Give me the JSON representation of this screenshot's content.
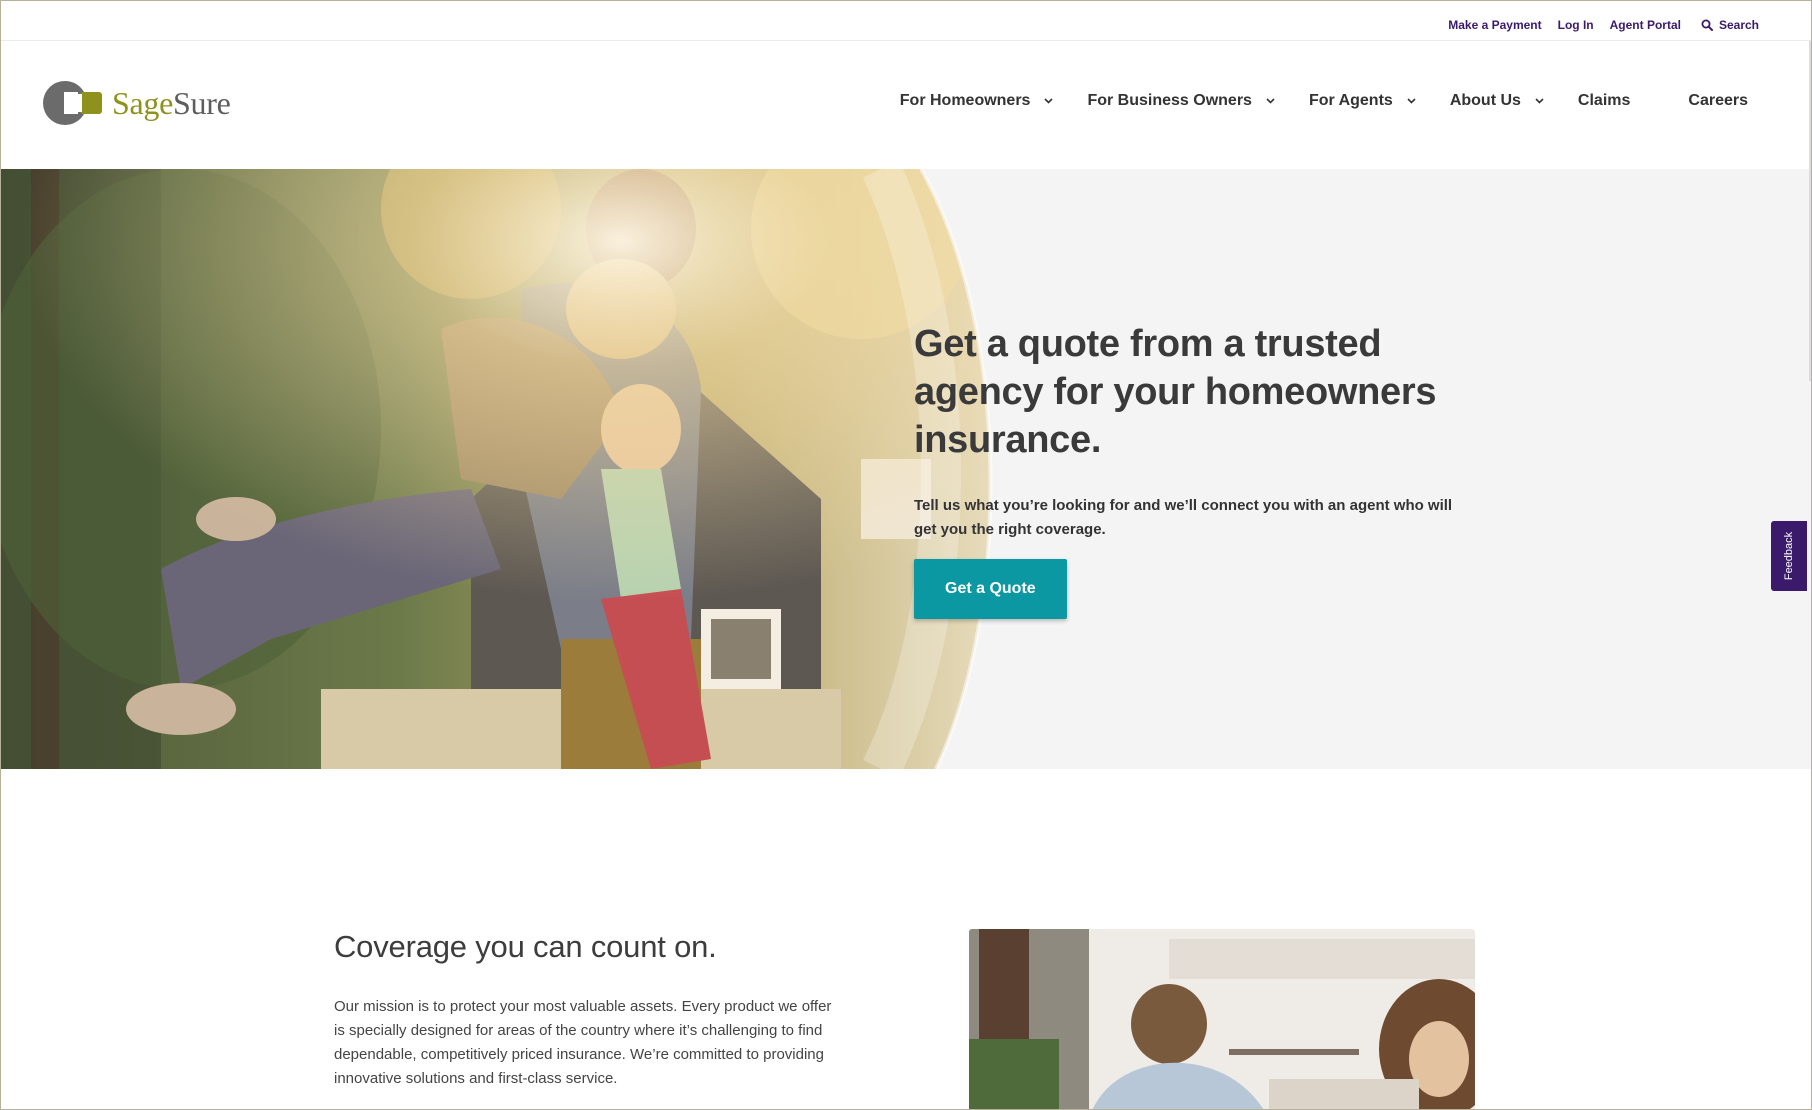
{
  "utility": {
    "make_payment": "Make a Payment",
    "log_in": "Log In",
    "agent_portal": "Agent Portal",
    "search": "Search"
  },
  "brand": {
    "name_part1": "Sage",
    "name_part2": "Sure",
    "accent_color": "#8e921d",
    "link_color": "#3b1a6b",
    "button_color": "#0b98a3"
  },
  "nav": {
    "items": [
      {
        "label": "For Homeowners",
        "has_dropdown": true
      },
      {
        "label": "For Business Owners",
        "has_dropdown": true
      },
      {
        "label": "For Agents",
        "has_dropdown": true
      },
      {
        "label": "About Us",
        "has_dropdown": true
      },
      {
        "label": "Claims",
        "has_dropdown": false
      },
      {
        "label": "Careers",
        "has_dropdown": false
      }
    ]
  },
  "hero": {
    "title": "Get a quote from a trusted agency for your homeowners insurance.",
    "subtitle": "Tell us what you’re looking for and we’ll connect you with an agent who will get you the right coverage.",
    "cta_label": "Get a Quote"
  },
  "feedback": {
    "label": "Feedback"
  },
  "coverage": {
    "title": "Coverage you can count on.",
    "body": "Our mission is to protect your most valuable assets. Every product we offer is specially designed for areas of the country where it’s challenging to find dependable, competitively priced insurance. We’re committed to providing innovative solutions and first-class service."
  }
}
